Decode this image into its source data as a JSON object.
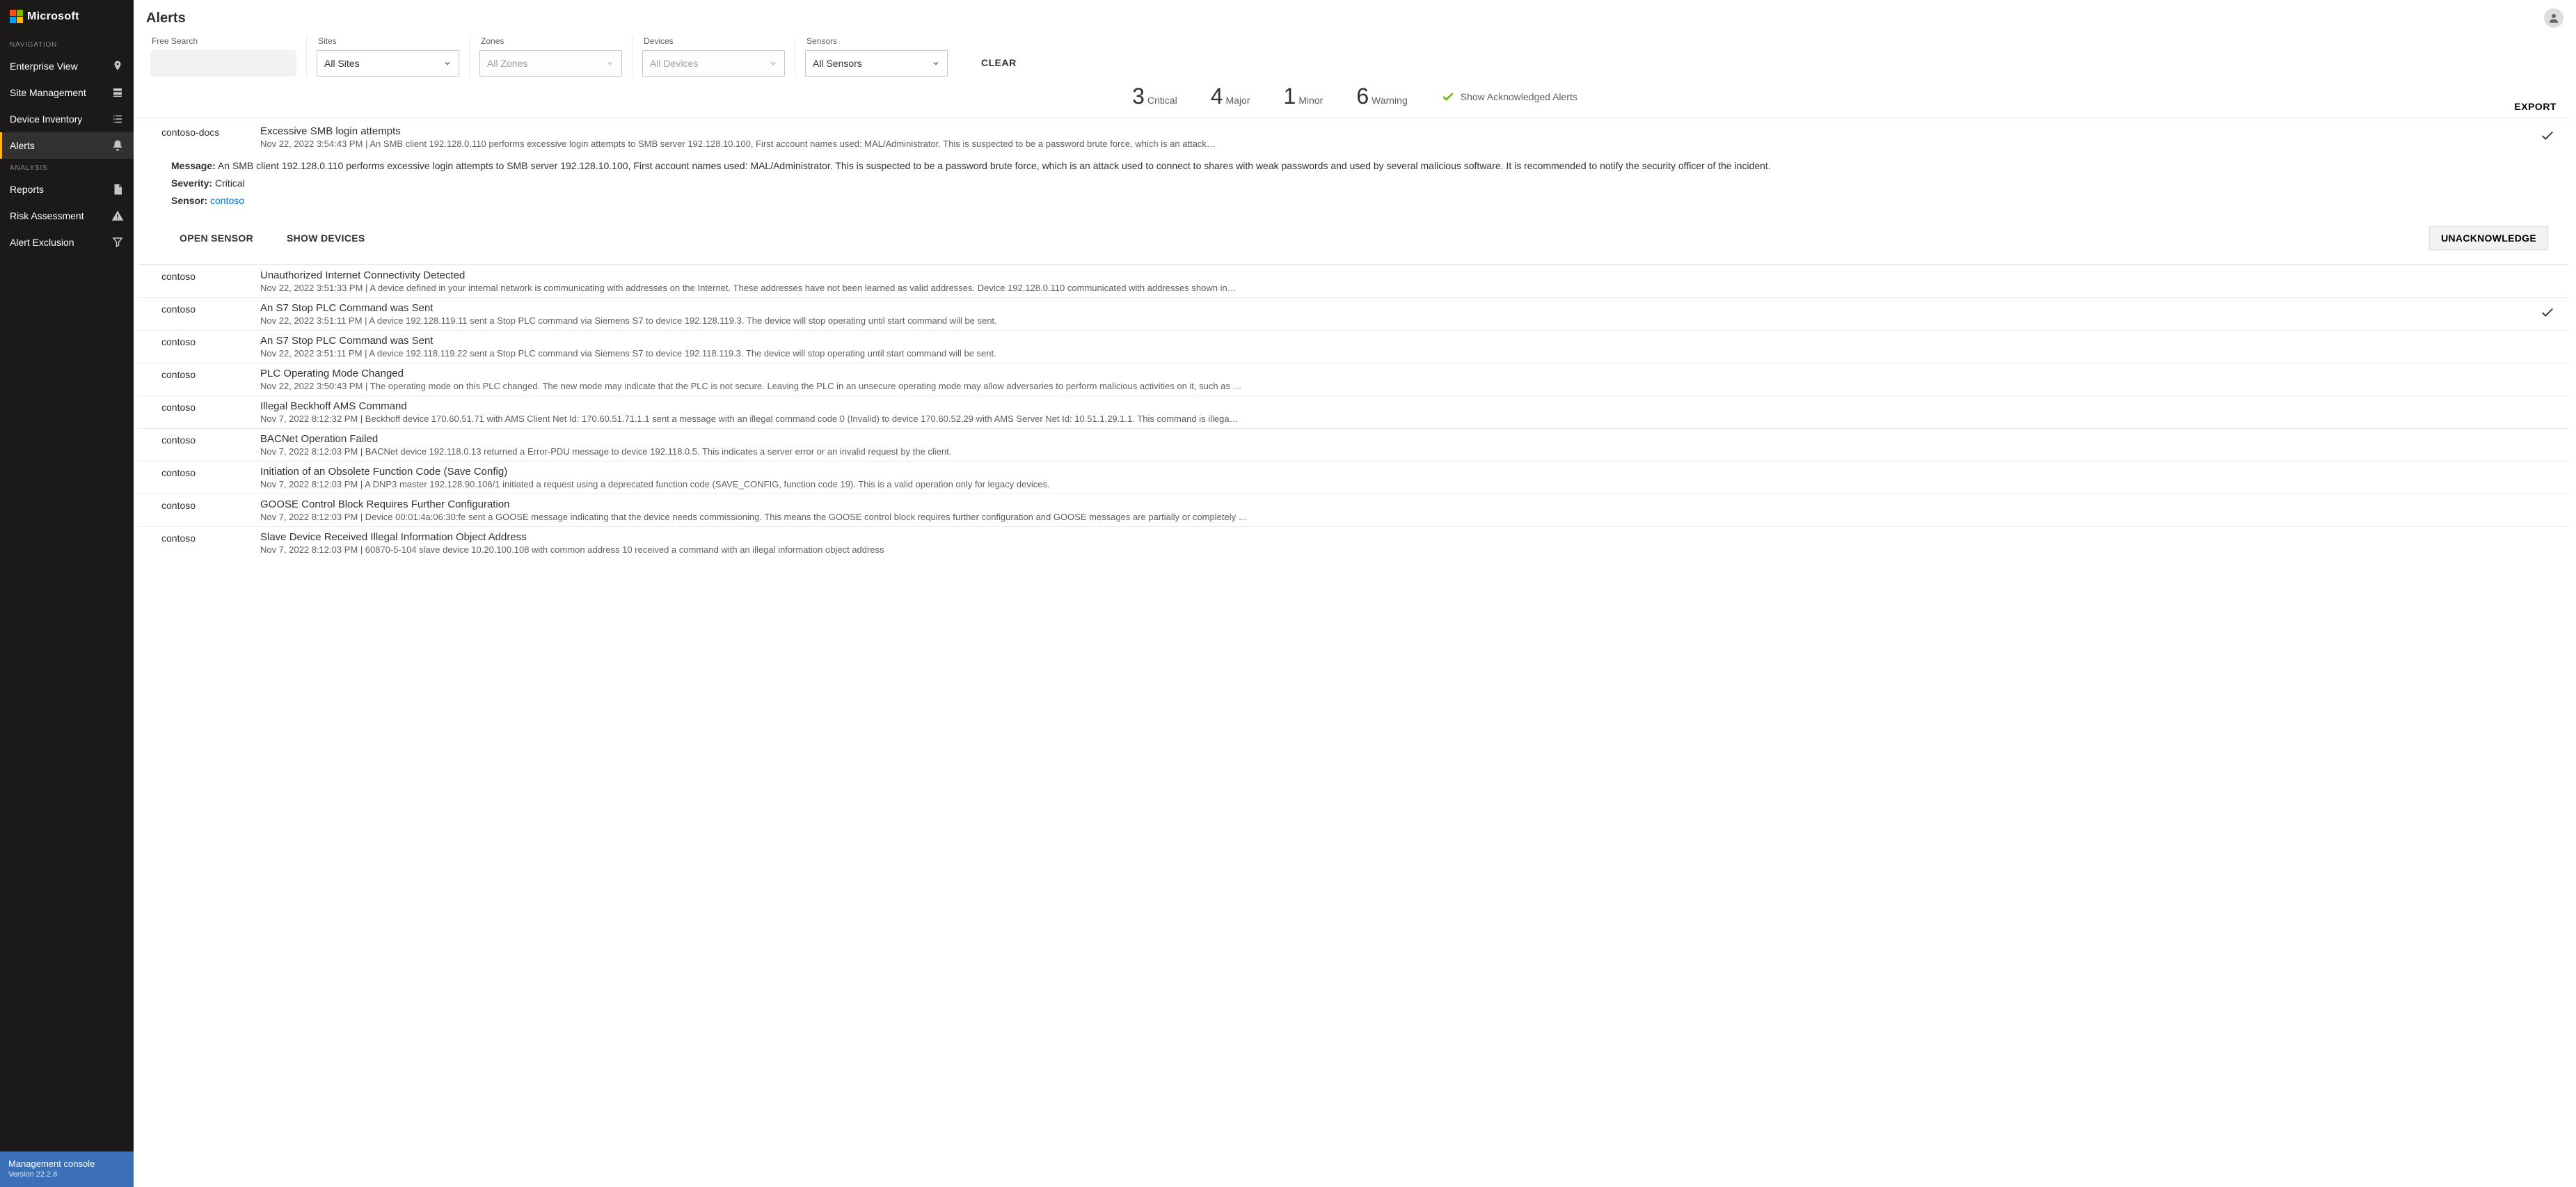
{
  "brand": {
    "text": "Microsoft"
  },
  "nav": {
    "heading1": "NAVIGATION",
    "heading2": "ANALYSIS",
    "items1": [
      {
        "label": "Enterprise View"
      },
      {
        "label": "Site Management"
      },
      {
        "label": "Device Inventory"
      },
      {
        "label": "Alerts"
      }
    ],
    "items2": [
      {
        "label": "Reports"
      },
      {
        "label": "Risk Assessment"
      },
      {
        "label": "Alert Exclusion"
      }
    ]
  },
  "footer": {
    "title": "Management console",
    "version": "Version 22.2.6"
  },
  "page": {
    "title": "Alerts"
  },
  "filters": {
    "search_label": "Free Search",
    "search_value": "",
    "sites_label": "Sites",
    "sites_value": "All Sites",
    "zones_label": "Zones",
    "zones_value": "All Zones",
    "devices_label": "Devices",
    "devices_value": "All Devices",
    "sensors_label": "Sensors",
    "sensors_value": "All Sensors",
    "clear": "CLEAR"
  },
  "summary": {
    "critical_n": "3",
    "critical_l": "Critical",
    "major_n": "4",
    "major_l": "Major",
    "minor_n": "1",
    "minor_l": "Minor",
    "warning_n": "6",
    "warning_l": "Warning",
    "ack_label": "Show Acknowledged Alerts",
    "export": "EXPORT"
  },
  "expanded": {
    "sensor": "contoso-docs",
    "title": "Excessive SMB login attempts",
    "meta": "Nov 22, 2022 3:54:43 PM | An SMB client 192.128.0.110 performs excessive login attempts to SMB server 192.128.10.100, First account names used: MAL/Administrator. This is suspected to be a password brute force, which is an attack…",
    "msg_label": "Message:",
    "msg": " An SMB client 192.128.0.110 performs excessive login attempts to SMB server 192.128.10.100, First account names used: MAL/Administrator. This is suspected to be a password brute force, which is an attack used to connect to shares with weak passwords and used by several malicious software. It is recommended to notify the security officer of the incident.",
    "sev_label": "Severity:",
    "sev": " Critical",
    "sensor_label": "Sensor:",
    "sensor_link": "contoso",
    "open_sensor": "OPEN SENSOR",
    "show_devices": "SHOW DEVICES",
    "unack": "UNACKNOWLEDGE"
  },
  "alerts": [
    {
      "sensor": "contoso",
      "title": "Unauthorized Internet Connectivity Detected",
      "meta": "Nov 22, 2022 3:51:33 PM | A device defined in your internal network is communicating with addresses on the Internet. These addresses have not been learned as valid addresses. Device 192.128.0.110 communicated with addresses shown in…",
      "ack": false
    },
    {
      "sensor": "contoso",
      "title": "An S7 Stop PLC Command was Sent",
      "meta": "Nov 22, 2022 3:51:11 PM | A device 192.128.119.11 sent a Stop PLC command via Siemens S7 to device 192.128.119.3. The device will stop operating until start command will be sent.",
      "ack": true
    },
    {
      "sensor": "contoso",
      "title": "An S7 Stop PLC Command was Sent",
      "meta": "Nov 22, 2022 3:51:11 PM | A device 192.118.119.22 sent a Stop PLC command via Siemens S7 to device 192.118.119.3. The device will stop operating until start command will be sent.",
      "ack": false
    },
    {
      "sensor": "contoso",
      "title": "PLC Operating Mode Changed",
      "meta": "Nov 22, 2022 3:50:43 PM | The operating mode on this PLC changed. The new mode may indicate that the PLC is not secure. Leaving the PLC in an unsecure operating mode may allow adversaries to perform malicious activities on it, such as …",
      "ack": false
    },
    {
      "sensor": "contoso",
      "title": "Illegal Beckhoff AMS Command",
      "meta": "Nov 7, 2022 8:12:32 PM | Beckhoff device 170.60.51.71 with AMS Client Net Id: 170.60.51.71.1.1 sent a message with an illegal command code 0 (Invalid) to device 170.60.52.29 with AMS Server Net Id: 10.51.1.29.1.1. This command is illega…",
      "ack": false
    },
    {
      "sensor": "contoso",
      "title": "BACNet Operation Failed",
      "meta": "Nov 7, 2022 8:12:03 PM | BACNet device 192.118.0.13 returned a Error-PDU message to device 192.118.0.5. This indicates a server error or an invalid request by the client.",
      "ack": false
    },
    {
      "sensor": "contoso",
      "title": "Initiation of an Obsolete Function Code (Save Config)",
      "meta": "Nov 7, 2022 8:12:03 PM | A DNP3 master 192.128.90.106/1 initiated a request using a deprecated function code (SAVE_CONFIG, function code 19). This is a valid operation only for legacy devices.",
      "ack": false
    },
    {
      "sensor": "contoso",
      "title": "GOOSE Control Block Requires Further Configuration",
      "meta": "Nov 7, 2022 8:12:03 PM | Device 00:01:4a:06:30:fe sent a GOOSE message indicating that the device needs commissioning. This means the GOOSE control block requires further configuration and GOOSE messages are partially or completely …",
      "ack": false
    },
    {
      "sensor": "contoso",
      "title": "Slave Device Received Illegal Information Object Address",
      "meta": "Nov 7, 2022 8:12:03 PM | 60870-5-104 slave device 10.20.100.108 with common address 10 received a command with an illegal information object address",
      "ack": false
    }
  ]
}
